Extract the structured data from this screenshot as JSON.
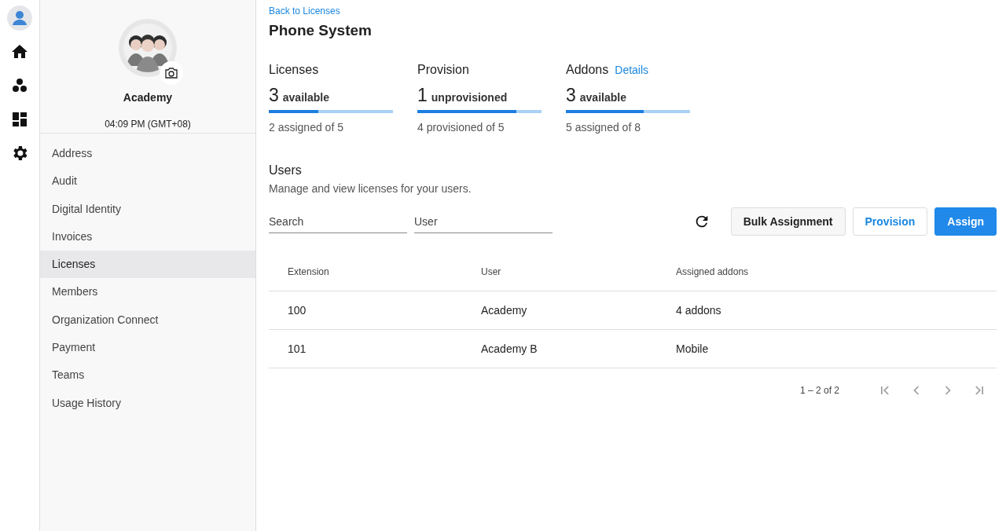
{
  "rail": {
    "items": [
      {
        "kind": "home",
        "selected": false
      },
      {
        "kind": "apps",
        "selected": false
      },
      {
        "kind": "dashboard",
        "selected": false
      },
      {
        "kind": "settings",
        "selected": false
      }
    ]
  },
  "profile": {
    "name": "Academy",
    "time": "04:09 PM (GMT+08)"
  },
  "sidebar": {
    "items": [
      {
        "label": "Address",
        "selected": false
      },
      {
        "label": "Audit",
        "selected": false
      },
      {
        "label": "Digital Identity",
        "selected": false
      },
      {
        "label": "Invoices",
        "selected": false
      },
      {
        "label": "Licenses",
        "selected": true
      },
      {
        "label": "Members",
        "selected": false
      },
      {
        "label": "Organization Connect",
        "selected": false
      },
      {
        "label": "Payment",
        "selected": false
      },
      {
        "label": "Teams",
        "selected": false
      },
      {
        "label": "Usage History",
        "selected": false
      }
    ]
  },
  "back_link": "Back to Licenses",
  "title": "Phone System",
  "stats": [
    {
      "heading": "Licenses",
      "count": "3",
      "unit": "available",
      "level": 0.4,
      "caption": "2 assigned of 5"
    },
    {
      "heading": "Provision",
      "count": "1",
      "unit": "unprovisioned",
      "level": 0.8,
      "caption": "4 provisioned of 5"
    },
    {
      "heading": "Addons",
      "link": "Details",
      "count": "3",
      "unit": "available",
      "level": 0.625,
      "caption": "5 assigned of 8"
    }
  ],
  "users": {
    "heading": "Users",
    "description": "Manage and view licenses for your users.",
    "fields": [
      {
        "placeholder": "Search"
      },
      {
        "placeholder": "User"
      }
    ],
    "buttons": [
      {
        "label": "Bulk Assignment",
        "kind": "default"
      },
      {
        "label": "Provision",
        "kind": "outline"
      },
      {
        "label": "Assign",
        "kind": "primary"
      }
    ],
    "table": {
      "columns": [
        "Extension",
        "User",
        "Assigned addons"
      ],
      "rows": [
        [
          "100",
          "Academy",
          "4 addons"
        ],
        [
          "101",
          "Academy B",
          "Mobile"
        ]
      ]
    },
    "pagination": "1 – 2 of 2"
  }
}
